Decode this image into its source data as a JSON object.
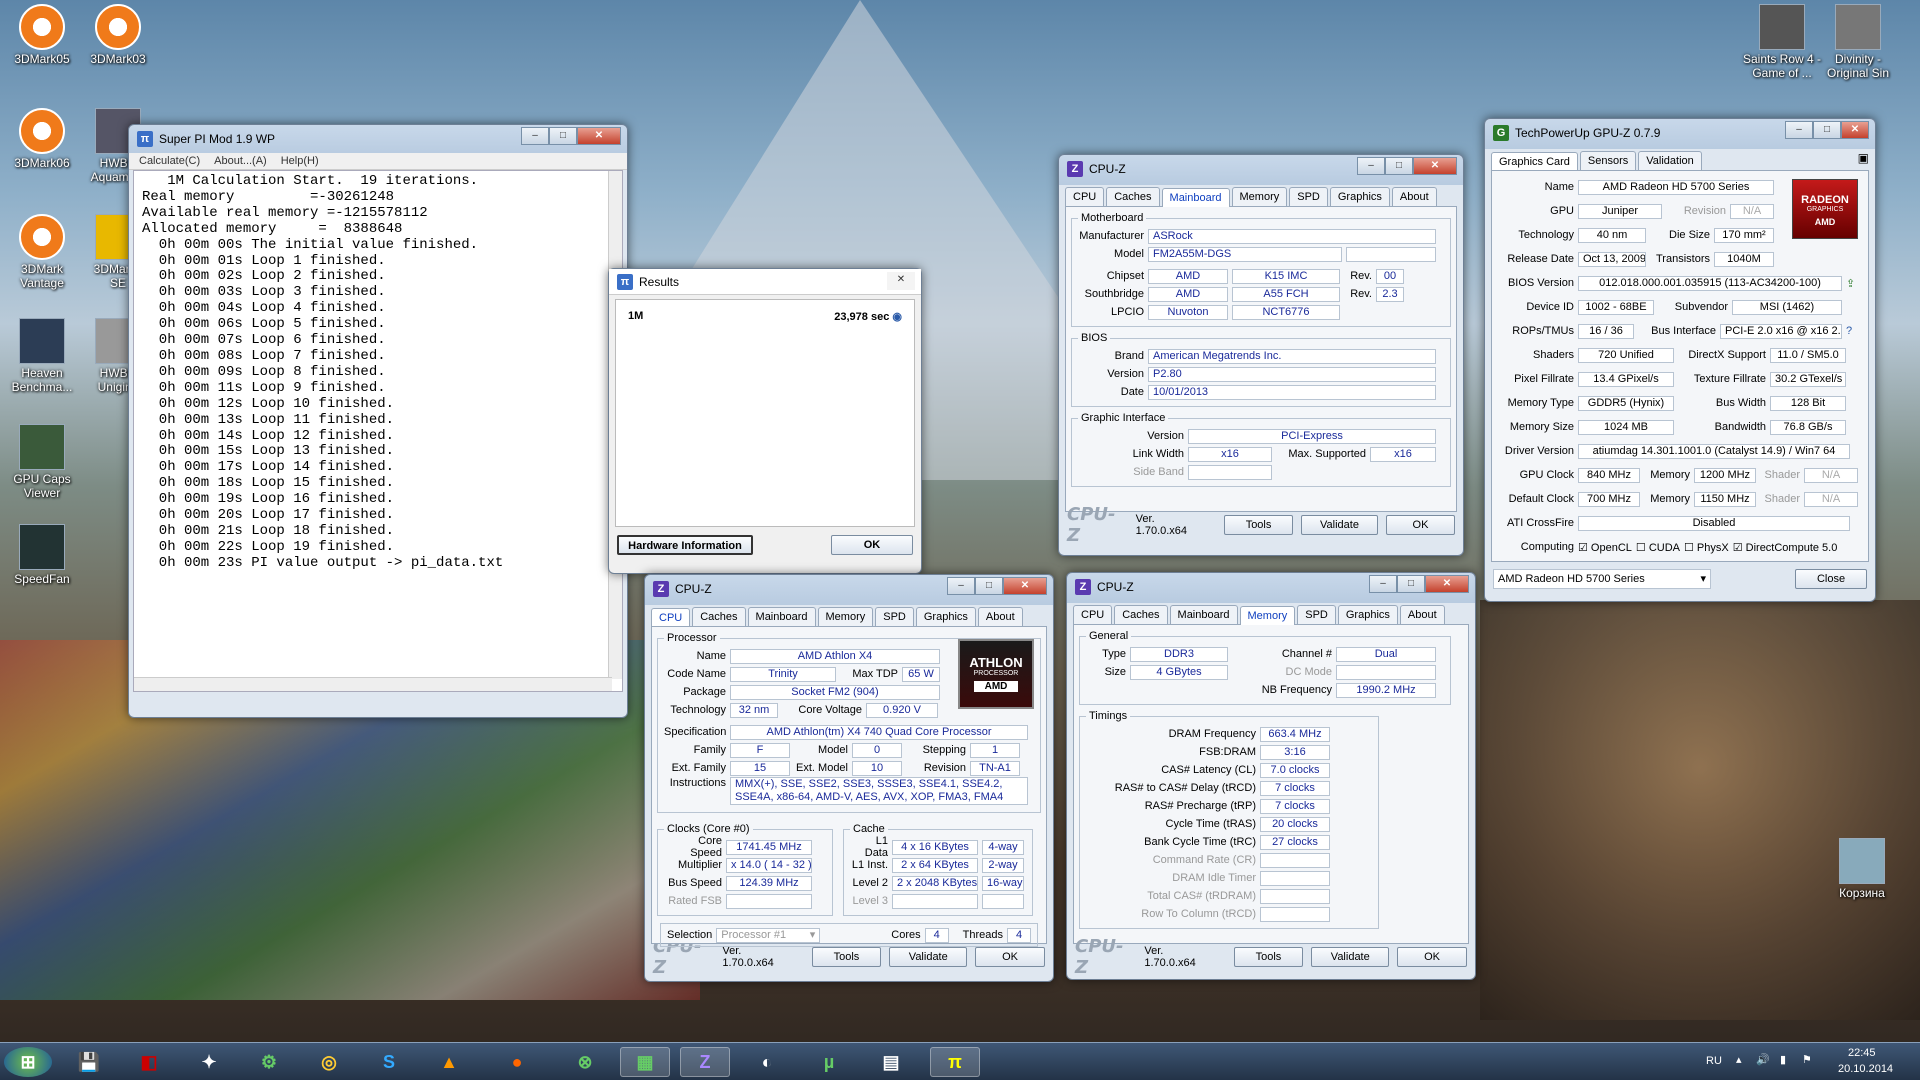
{
  "desktop": {
    "icons": [
      {
        "label": "3DMark05",
        "color": "#f07a1a"
      },
      {
        "label": "3DMark03",
        "color": "#f07a1a"
      },
      {
        "label": "3DMark06",
        "color": "#f07a1a"
      },
      {
        "label": "HWBC\nAquamark",
        "color": "#556"
      },
      {
        "label": "3DMark\nVantage",
        "color": "#f07a1a"
      },
      {
        "label": "3DMark2\nSE",
        "color": "#e8b800"
      },
      {
        "label": "Heaven\nBenchma...",
        "color": "#2c3d55"
      },
      {
        "label": "HWBC\nUnigine",
        "color": "#999"
      },
      {
        "label": "GPU Caps\nViewer",
        "color": "#3a5a3a"
      },
      {
        "label": "SpeedFan",
        "color": "#233"
      },
      {
        "label": "Saints Row 4 -\nGame of ...",
        "color": "#555"
      },
      {
        "label": "Divinity -\nOriginal Sin",
        "color": "#777"
      },
      {
        "label": "Корзина",
        "color": "#8ab"
      }
    ]
  },
  "superpi": {
    "title": "Super PI Mod 1.9 WP",
    "menu": [
      "Calculate(C)",
      "About...(A)",
      "Help(H)"
    ],
    "lines": [
      "   1M Calculation Start.  19 iterations.",
      "Real memory         =-30261248",
      "Available real memory =-1215578112",
      "Allocated memory     =  8388648",
      "  0h 00m 00s The initial value finished.",
      "  0h 00m 01s Loop 1 finished.",
      "  0h 00m 02s Loop 2 finished.",
      "  0h 00m 03s Loop 3 finished.",
      "  0h 00m 04s Loop 4 finished.",
      "  0h 00m 06s Loop 5 finished.",
      "  0h 00m 07s Loop 6 finished.",
      "  0h 00m 08s Loop 7 finished.",
      "  0h 00m 09s Loop 8 finished.",
      "  0h 00m 11s Loop 9 finished.",
      "  0h 00m 12s Loop 10 finished.",
      "  0h 00m 13s Loop 11 finished.",
      "  0h 00m 14s Loop 12 finished.",
      "  0h 00m 15s Loop 13 finished.",
      "  0h 00m 17s Loop 14 finished.",
      "  0h 00m 18s Loop 15 finished.",
      "  0h 00m 19s Loop 16 finished.",
      "  0h 00m 20s Loop 17 finished.",
      "  0h 00m 21s Loop 18 finished.",
      "  0h 00m 22s Loop 19 finished.",
      "  0h 00m 23s PI value output -> pi_data.txt"
    ]
  },
  "results": {
    "title": "Results",
    "label": "1M",
    "time": "23,978 sec",
    "hw_button": "Hardware Information",
    "ok": "OK"
  },
  "cpuz_tabs": [
    "CPU",
    "Caches",
    "Mainboard",
    "Memory",
    "SPD",
    "Graphics",
    "About"
  ],
  "cpuz_common": {
    "title": "CPU-Z",
    "logo": "CPU-Z",
    "version": "Ver. 1.70.0.x64",
    "tools": "Tools",
    "validate": "Validate",
    "ok": "OK"
  },
  "mainboard": {
    "legend": "Motherboard",
    "manufacturer_lbl": "Manufacturer",
    "manufacturer": "ASRock",
    "model_lbl": "Model",
    "model": "FM2A55M-DGS",
    "chipset_lbl": "Chipset",
    "chipset": "AMD",
    "chipset2": "K15 IMC",
    "rev_lbl": "Rev.",
    "chipset_rev": "00",
    "south_lbl": "Southbridge",
    "south": "AMD",
    "south2": "A55 FCH",
    "south_rev": "2.3",
    "lpcio_lbl": "LPCIO",
    "lpcio": "Nuvoton",
    "lpcio2": "NCT6776",
    "bios_legend": "BIOS",
    "brand_lbl": "Brand",
    "brand": "American Megatrends Inc.",
    "version_lbl": "Version",
    "version": "P2.80",
    "date_lbl": "Date",
    "date": "10/01/2013",
    "gi_legend": "Graphic Interface",
    "gi_version_lbl": "Version",
    "gi_version": "PCI-Express",
    "link_lbl": "Link Width",
    "link": "x16",
    "max_lbl": "Max. Supported",
    "max": "x16",
    "side_lbl": "Side Band"
  },
  "cpu": {
    "legend": "Processor",
    "name_lbl": "Name",
    "name": "AMD Athlon X4",
    "code_lbl": "Code Name",
    "code": "Trinity",
    "tdp_lbl": "Max TDP",
    "tdp": "65 W",
    "pkg_lbl": "Package",
    "pkg": "Socket FM2 (904)",
    "tech_lbl": "Technology",
    "tech": "32 nm",
    "cv_lbl": "Core Voltage",
    "cv": "0.920 V",
    "spec_lbl": "Specification",
    "spec": "AMD Athlon(tm) X4 740 Quad Core Processor",
    "family_lbl": "Family",
    "family": "F",
    "model_lbl": "Model",
    "model": "0",
    "stepping_lbl": "Stepping",
    "stepping": "1",
    "extfam_lbl": "Ext. Family",
    "extfam": "15",
    "extmodel_lbl": "Ext. Model",
    "extmodel": "10",
    "rev_lbl": "Revision",
    "rev": "TN-A1",
    "instr_lbl": "Instructions",
    "instr": "MMX(+), SSE, SSE2, SSE3, SSSE3, SSE4.1, SSE4.2, SSE4A, x86-64, AMD-V, AES, AVX, XOP, FMA3, FMA4",
    "clocks_legend": "Clocks (Core #0)",
    "cs_lbl": "Core Speed",
    "cs": "1741.45 MHz",
    "mult_lbl": "Multiplier",
    "mult": "x 14.0 ( 14 - 32 )",
    "bus_lbl": "Bus Speed",
    "bus": "124.39 MHz",
    "rfsb_lbl": "Rated FSB",
    "cache_legend": "Cache",
    "l1d_lbl": "L1 Data",
    "l1d": "4 x 16 KBytes",
    "l1d_w": "4-way",
    "l1i_lbl": "L1 Inst.",
    "l1i": "2 x 64 KBytes",
    "l1i_w": "2-way",
    "l2_lbl": "Level 2",
    "l2": "2 x 2048 KBytes",
    "l2_w": "16-way",
    "l3_lbl": "Level 3",
    "sel_lbl": "Selection",
    "sel": "Processor #1",
    "cores_lbl": "Cores",
    "cores": "4",
    "threads_lbl": "Threads",
    "threads": "4",
    "logo_top": "ATHLON",
    "logo_mid": "PROCESSOR",
    "logo_bot": "AMD"
  },
  "memory": {
    "legend": "General",
    "type_lbl": "Type",
    "type": "DDR3",
    "ch_lbl": "Channel #",
    "ch": "Dual",
    "size_lbl": "Size",
    "size": "4 GBytes",
    "dc_lbl": "DC Mode",
    "nb_lbl": "NB Frequency",
    "nb": "1990.2 MHz",
    "timings_legend": "Timings",
    "rows": [
      {
        "l": "DRAM Frequency",
        "v": "663.4 MHz"
      },
      {
        "l": "FSB:DRAM",
        "v": "3:16"
      },
      {
        "l": "CAS# Latency (CL)",
        "v": "7.0 clocks"
      },
      {
        "l": "RAS# to CAS# Delay (tRCD)",
        "v": "7 clocks"
      },
      {
        "l": "RAS# Precharge (tRP)",
        "v": "7 clocks"
      },
      {
        "l": "Cycle Time (tRAS)",
        "v": "20 clocks"
      },
      {
        "l": "Bank Cycle Time (tRC)",
        "v": "27 clocks"
      },
      {
        "l": "Command Rate (CR)",
        "v": ""
      },
      {
        "l": "DRAM Idle Timer",
        "v": ""
      },
      {
        "l": "Total CAS# (tRDRAM)",
        "v": ""
      },
      {
        "l": "Row To Column (tRCD)",
        "v": ""
      }
    ]
  },
  "gpuz": {
    "title": "TechPowerUp GPU-Z 0.7.9",
    "tabs": [
      "Graphics Card",
      "Sensors",
      "Validation"
    ],
    "name_lbl": "Name",
    "name": "AMD Radeon HD 5700 Series",
    "gpu_lbl": "GPU",
    "gpu": "Juniper",
    "rev_lbl": "Revision",
    "rev": "N/A",
    "tech_lbl": "Technology",
    "tech": "40 nm",
    "die_lbl": "Die Size",
    "die": "170 mm²",
    "rel_lbl": "Release Date",
    "rel": "Oct 13, 2009",
    "trans_lbl": "Transistors",
    "trans": "1040M",
    "bios_lbl": "BIOS Version",
    "bios": "012.018.000.001.035915 (113-AC34200-100)",
    "dev_lbl": "Device ID",
    "dev": "1002 - 68BE",
    "sub_lbl": "Subvendor",
    "sub": "MSI (1462)",
    "rops_lbl": "ROPs/TMUs",
    "rops": "16 / 36",
    "bus_lbl": "Bus Interface",
    "bus": "PCI-E 2.0 x16 @ x16 2.0",
    "shaders_lbl": "Shaders",
    "shaders": "720 Unified",
    "dx_lbl": "DirectX Support",
    "dx": "11.0 / SM5.0",
    "pf_lbl": "Pixel Fillrate",
    "pf": "13.4 GPixel/s",
    "tf_lbl": "Texture Fillrate",
    "tf": "30.2 GTexel/s",
    "mt_lbl": "Memory Type",
    "mt": "GDDR5 (Hynix)",
    "bw_lbl": "Bus Width",
    "bw": "128 Bit",
    "ms_lbl": "Memory Size",
    "ms": "1024 MB",
    "band_lbl": "Bandwidth",
    "band": "76.8 GB/s",
    "drv_lbl": "Driver Version",
    "drv": "atiumdag 14.301.1001.0 (Catalyst 14.9) / Win7 64",
    "gc_lbl": "GPU Clock",
    "gc": "840 MHz",
    "mem_lbl": "Memory",
    "mem": "1200 MHz",
    "sh_lbl": "Shader",
    "sh": "N/A",
    "dc_lbl": "Default Clock",
    "dc": "700 MHz",
    "dmem": "1150 MHz",
    "dsh": "N/A",
    "cf_lbl": "ATI CrossFire",
    "cf": "Disabled",
    "comp_lbl": "Computing",
    "opencl": "OpenCL",
    "cuda": "CUDA",
    "physx": "PhysX",
    "dcomp": "DirectCompute 5.0",
    "select": "AMD Radeon HD 5700 Series",
    "close": "Close",
    "logo_top": "RADEON",
    "logo_mid": "GRAPHICS",
    "logo_bot": "AMD"
  },
  "taskbar": {
    "lang": "RU",
    "time": "22:45",
    "date": "20.10.2014"
  }
}
